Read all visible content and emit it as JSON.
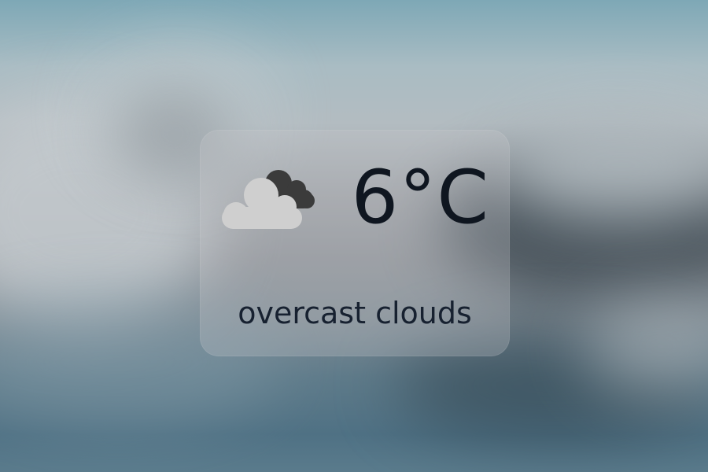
{
  "background": {
    "description_icon": "blurred-landscape",
    "accent_top": "#7ea8b6",
    "accent_bottom": "#4f7184"
  },
  "weather": {
    "icon": "cloud-icon",
    "temperature": "6°C",
    "description": "overcast clouds"
  },
  "colors": {
    "text": "#0f1620",
    "card": "rgba(200,200,204,0.28)",
    "cloud_front": "#cfcfcf",
    "cloud_back": "#3a3a3a"
  }
}
